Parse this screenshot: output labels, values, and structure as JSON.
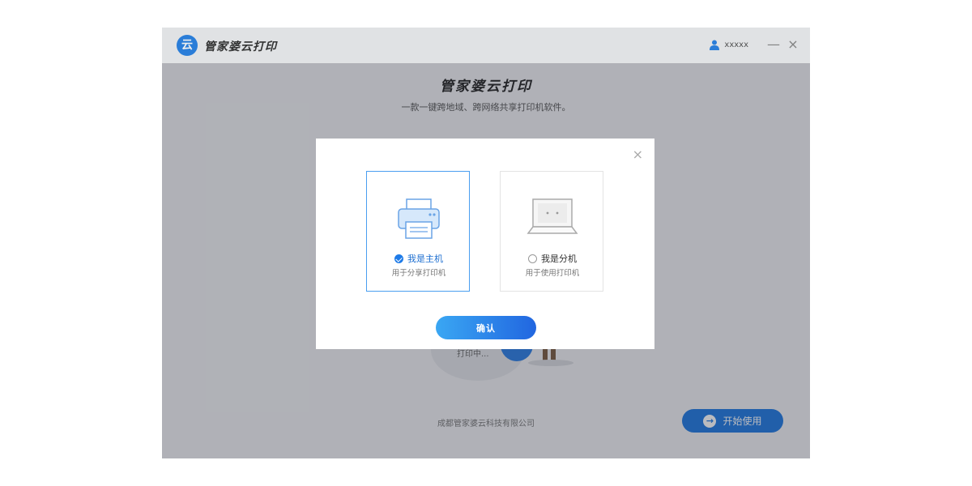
{
  "app": {
    "logo_char": "云",
    "name": "管家婆云打印",
    "user_name": "xxxxx",
    "minimize_glyph": "—",
    "close_glyph": "×"
  },
  "hero": {
    "title": "管家婆云打印",
    "subtitle": "一款一键跨地域、跨网络共享打印机软件。"
  },
  "background": {
    "printing_text": "打印中...",
    "company": "成都管家婆云科技有限公司",
    "start_button": "开始使用",
    "start_icon": "→"
  },
  "modal": {
    "close_glyph": "×",
    "options": [
      {
        "label": "我是主机",
        "desc": "用于分享打印机",
        "selected": true,
        "icon": "printer-icon"
      },
      {
        "label": "我是分机",
        "desc": "用于使用打印机",
        "selected": false,
        "icon": "laptop-icon"
      }
    ],
    "confirm_button": "确认"
  },
  "colors": {
    "accent": "#1e78e0",
    "selected_border": "#4a9ef0",
    "overlay": "#282d37"
  }
}
